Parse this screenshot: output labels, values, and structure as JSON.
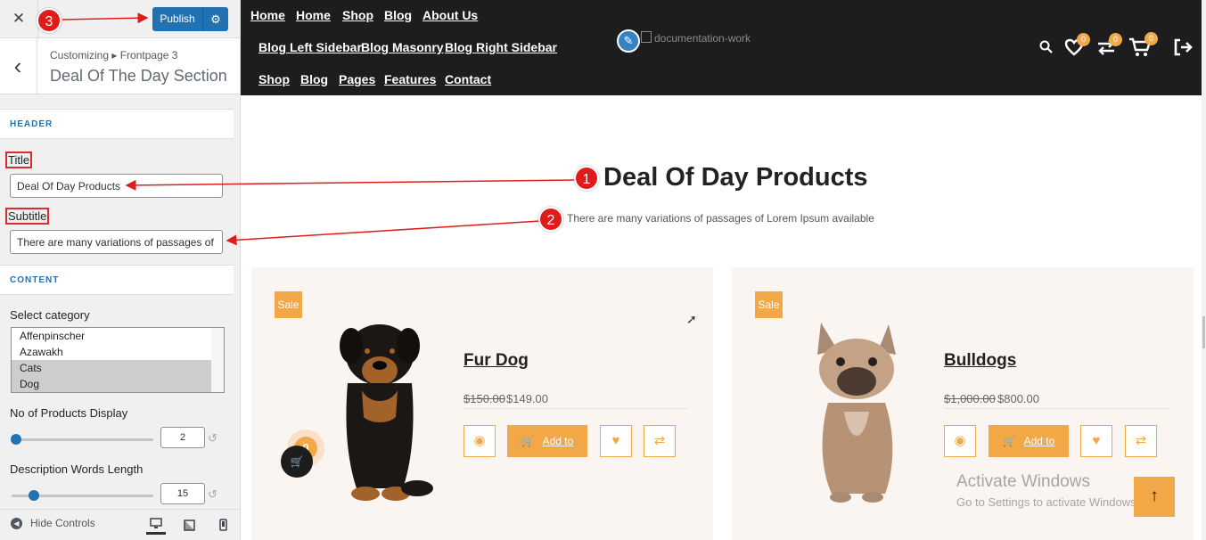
{
  "customizer": {
    "close_icon": "✕",
    "publish_label": "Publish",
    "publish_gear": "⚙",
    "back_icon": "‹",
    "breadcrumb": "Customizing ▸ Frontpage 3",
    "section_title": "Deal Of The Day Section",
    "header_group": "HEADER",
    "title_label": "Title",
    "title_value": "Deal Of Day Products",
    "subtitle_label": "Subtitle",
    "subtitle_value": "There are many variations of passages of",
    "content_group": "CONTENT",
    "category_label": "Select category",
    "categories": [
      {
        "name": "Affenpinscher",
        "selected": false
      },
      {
        "name": "Azawakh",
        "selected": false
      },
      {
        "name": "Cats",
        "selected": true
      },
      {
        "name": "Dog",
        "selected": true
      }
    ],
    "products_label": "No of Products Display",
    "products_value": "2",
    "words_label": "Description Words Length",
    "words_value": "15",
    "reset_icon": "↺",
    "hide_controls": "Hide Controls",
    "device_active": "desktop"
  },
  "nav": {
    "row1": [
      "Home",
      "Home",
      "Shop",
      "Blog",
      "About Us"
    ],
    "row2": [
      "Blog Left Sidebar",
      "Blog Masonry",
      "Blog Right Sidebar"
    ],
    "row3": [
      "Shop",
      "Blog",
      "Pages",
      "Features",
      "Contact"
    ],
    "logo_alt": "documentation-work",
    "edit_icon": "✎",
    "wishlist_count": "0",
    "compare_count": "0",
    "cart_count": "0"
  },
  "section": {
    "title": "Deal Of Day Products",
    "subtitle": "There are many variations of passages of Lorem Ipsum available"
  },
  "products": [
    {
      "sale": "Sale",
      "name": "Fur Dog",
      "old_price": "$150.00",
      "new_price": "$149.00",
      "add_to": "Add to"
    },
    {
      "sale": "Sale",
      "name": "Bulldogs",
      "old_price": "$1,000.00",
      "new_price": "$800.00",
      "add_to": "Add to"
    }
  ],
  "floating_cart_count": "0",
  "watermark": {
    "line1": "Activate Windows",
    "line2": "Go to Settings to activate Windows."
  },
  "back_to_top": "↑",
  "annotations": {
    "a1": "1",
    "a2": "2",
    "a3": "3"
  },
  "colors": {
    "accent": "#f3a847",
    "wp_blue": "#2271b1",
    "annotation": "#e01b1b",
    "nav_bg": "#1d1d1d"
  }
}
